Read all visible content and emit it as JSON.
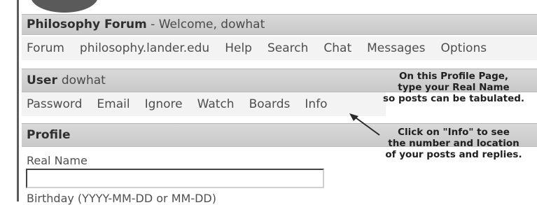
{
  "header": {
    "site_title": "Philosophy Forum",
    "welcome_text": " - Welcome, dowhat"
  },
  "main_nav": {
    "items": [
      "Forum",
      "philosophy.lander.edu",
      "Help",
      "Search",
      "Chat",
      "Messages",
      "Options"
    ]
  },
  "user_section": {
    "label": "User",
    "username": "dowhat",
    "tabs": [
      "Password",
      "Email",
      "Ignore",
      "Watch",
      "Boards",
      "Info"
    ]
  },
  "profile": {
    "heading": "Profile",
    "real_name_label": "Real Name",
    "real_name_value": "",
    "birthday_label": "Birthday (YYYY-MM-DD or MM-DD)"
  },
  "annotations": {
    "note_profile": [
      "On this Profile Page,",
      "type your Real Name",
      "so posts can be tabulated."
    ],
    "note_info": [
      "Click on \"Info\" to see",
      "the number and location",
      "of your posts and replies."
    ]
  },
  "icons": [
    "arrow-icon"
  ],
  "colors": {
    "bar_background": "#d0d0d0",
    "menu_background": "#f3f3f3",
    "input_border": "#454545"
  }
}
